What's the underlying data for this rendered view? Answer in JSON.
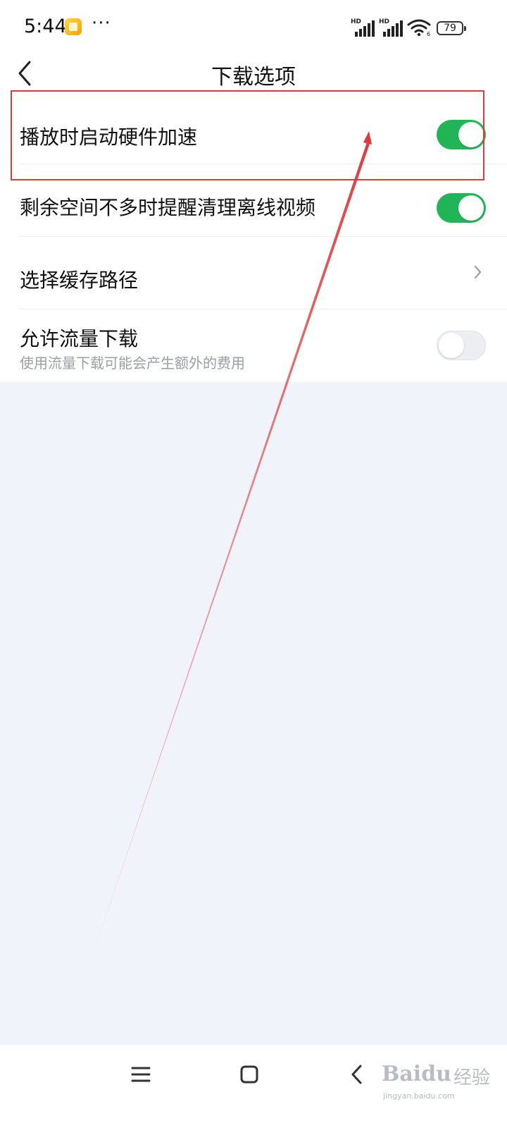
{
  "status_bar": {
    "time": "5:44",
    "more": "···",
    "signal_1_label": "HD",
    "signal_2_label": "HD",
    "battery": "79",
    "icons": [
      "notification-app-icon",
      "signal-icon",
      "signal-icon",
      "wifi-icon",
      "battery-icon"
    ]
  },
  "header": {
    "title": "下载选项",
    "back_icon": "back-chevron-icon"
  },
  "settings": {
    "items": [
      {
        "label": "播放时启动硬件加速",
        "control": "toggle",
        "on": true
      },
      {
        "label": "剩余空间不多时提醒清理离线视频",
        "control": "toggle",
        "on": true
      },
      {
        "label": "选择缓存路径",
        "control": "chevron"
      },
      {
        "label": "允许流量下载",
        "sublabel": "使用流量下载可能会产生额外的费用",
        "control": "toggle",
        "on": false
      }
    ]
  },
  "nav_bar": {
    "icons": [
      "menu-icon",
      "home-icon",
      "back-icon"
    ]
  },
  "watermark": {
    "brand": "Baidu",
    "brand_cn": "经验",
    "url": "jingyan.baidu.com"
  },
  "colors": {
    "toggle_on": "#21b557",
    "toggle_off": "#eceef1",
    "annotation": "#e0393a",
    "page_background": "#f0f3f9"
  }
}
